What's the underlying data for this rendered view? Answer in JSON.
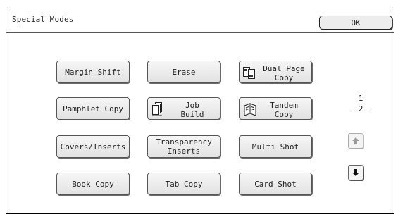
{
  "header": {
    "title": "Special Modes",
    "ok_label": "OK"
  },
  "buttons": {
    "margin_shift": "Margin Shift",
    "erase": "Erase",
    "dual_page_copy": "Dual Page\nCopy",
    "pamphlet_copy": "Pamphlet Copy",
    "job_build": "Job\nBuild",
    "tandem_copy": "Tandem\nCopy",
    "covers_inserts": "Covers/Inserts",
    "transparency_inserts": "Transparency\nInserts",
    "multi_shot": "Multi Shot",
    "book_copy": "Book Copy",
    "tab_copy": "Tab Copy",
    "card_shot": "Card Shot"
  },
  "pager": {
    "current": "1",
    "total": "2"
  },
  "icons": {
    "dual_page": "dual-page-icon",
    "job_build": "job-build-icon",
    "tandem": "tandem-icon",
    "up": "arrow-up-icon",
    "down": "arrow-down-icon"
  }
}
